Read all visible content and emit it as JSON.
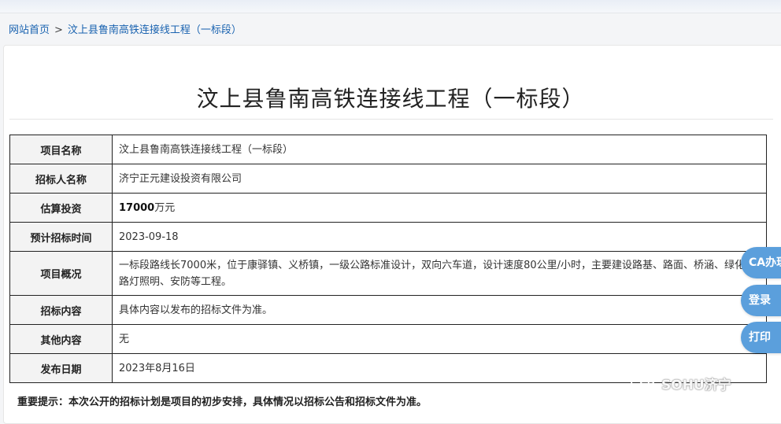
{
  "breadcrumb": {
    "home": "网站首页",
    "separator": ">",
    "current": "汶上县鲁南高铁连接线工程（一标段）"
  },
  "page_title": "汶上县鲁南高铁连接线工程（一标段）",
  "table": {
    "rows": [
      {
        "label": "项目名称",
        "value": "汶上县鲁南高铁连接线工程（一标段）"
      },
      {
        "label": "招标人名称",
        "value": "济宁正元建设投资有限公司"
      },
      {
        "label": "估算投资",
        "value_bold": "17000",
        "value_suffix": "万元"
      },
      {
        "label": "预计招标时间",
        "value": "2023-09-18"
      },
      {
        "label": "项目概况",
        "value": "一标段路线长7000米，位于康驿镇、义桥镇，一级公路标准设计，双向六车道，设计速度80公里/小时，主要建设路基、路面、桥涵、绿化、路灯照明、安防等工程。"
      },
      {
        "label": "招标内容",
        "value": "具体内容以发布的招标文件为准。"
      },
      {
        "label": "其他内容",
        "value": "无"
      },
      {
        "label": "发布日期",
        "value": "2023年8月16日"
      }
    ]
  },
  "notice": "重要提示：本次公开的招标计划是项目的初步安排，具体情况以招标公告和招标文件为准。",
  "side_buttons": {
    "ca": "CA办理",
    "login": "登录",
    "print": "打印"
  },
  "watermark": {
    "icon": "wechat-icon",
    "text": "SOHU济宁"
  },
  "colors": {
    "link": "#1a63b0",
    "side_button": "#5b9fdc",
    "label_bg": "#f3f3f3"
  }
}
